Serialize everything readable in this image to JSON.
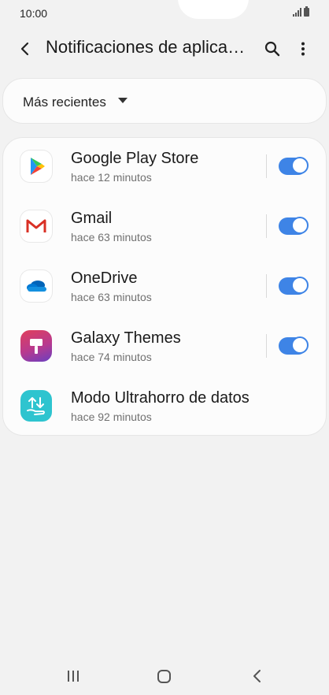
{
  "status": {
    "time": "10:00"
  },
  "header": {
    "title": "Notificaciones de aplicaciones"
  },
  "filter": {
    "label": "Más recientes"
  },
  "apps": [
    {
      "name": "Google Play Store",
      "time": "hace 12 minutos",
      "icon": "google-play-store-icon",
      "enabled": true
    },
    {
      "name": "Gmail",
      "time": "hace 63 minutos",
      "icon": "gmail-icon",
      "enabled": true
    },
    {
      "name": "OneDrive",
      "time": "hace 63 minutos",
      "icon": "onedrive-icon",
      "enabled": true
    },
    {
      "name": "Galaxy Themes",
      "time": "hace 74 minutos",
      "icon": "galaxy-themes-icon",
      "enabled": true
    },
    {
      "name": "Modo Ultrahorro de datos",
      "time": "hace 92 minutos",
      "icon": "data-saver-icon",
      "enabled": null
    }
  ],
  "colors": {
    "accent": "#3e84e6",
    "background": "#f2f2f2",
    "card": "#fcfcfc"
  }
}
